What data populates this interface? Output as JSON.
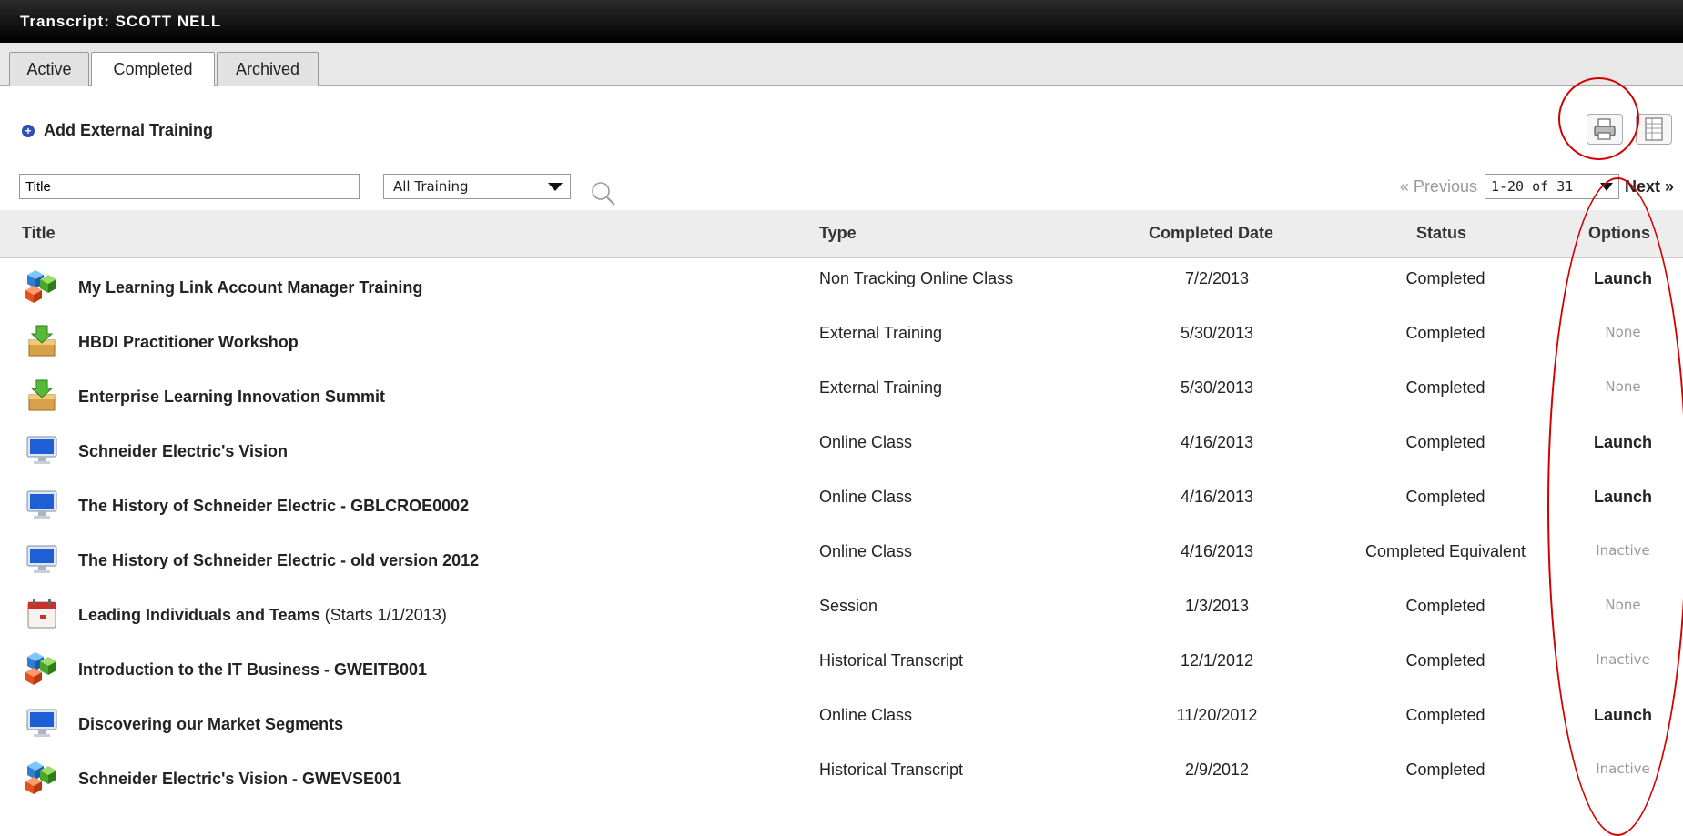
{
  "header": {
    "title": "Transcript: SCOTT NELL"
  },
  "tabs": [
    {
      "label": "Active"
    },
    {
      "label": "Completed",
      "active": true
    },
    {
      "label": "Archived"
    }
  ],
  "actions": {
    "add_external": "Add External Training"
  },
  "filter": {
    "title_value": "Title",
    "type_selected": "All Training"
  },
  "pager": {
    "prev": "« Previous",
    "range": "1-20 of 31",
    "next": "Next »"
  },
  "columns": {
    "title": "Title",
    "type": "Type",
    "date": "Completed Date",
    "status": "Status",
    "options": "Options"
  },
  "rows": [
    {
      "icon": "cubes-icon",
      "title": "My Learning Link Account Manager Training",
      "type": "Non Tracking Online Class",
      "date": "7/2/2013",
      "status": "Completed",
      "option": "Launch"
    },
    {
      "icon": "inbox-download-icon",
      "title": "HBDI Practitioner Workshop",
      "type": "External Training",
      "date": "5/30/2013",
      "status": "Completed",
      "option": "None"
    },
    {
      "icon": "inbox-download-icon",
      "title": "Enterprise Learning Innovation Summit",
      "type": "External Training",
      "date": "5/30/2013",
      "status": "Completed",
      "option": "None"
    },
    {
      "icon": "monitor-icon",
      "title": "Schneider Electric's Vision",
      "type": "Online Class",
      "date": "4/16/2013",
      "status": "Completed",
      "option": "Launch"
    },
    {
      "icon": "monitor-icon",
      "title": "The History of Schneider Electric - GBLCROE0002",
      "type": "Online Class",
      "date": "4/16/2013",
      "status": "Completed",
      "option": "Launch"
    },
    {
      "icon": "monitor-icon",
      "title": "The History of Schneider Electric - old version 2012",
      "type": "Online Class",
      "date": "4/16/2013",
      "status": "Completed Equivalent",
      "option": "Inactive"
    },
    {
      "icon": "calendar-icon",
      "title": "Leading Individuals and Teams",
      "title_suffix": "(Starts 1/1/2013)",
      "type": "Session",
      "date": "1/3/2013",
      "status": "Completed",
      "option": "None"
    },
    {
      "icon": "cubes-icon",
      "title": "Introduction to the IT Business - GWEITB001",
      "type": "Historical Transcript",
      "date": "12/1/2012",
      "status": "Completed",
      "option": "Inactive"
    },
    {
      "icon": "monitor-icon",
      "title": "Discovering our Market Segments",
      "type": "Online Class",
      "date": "11/20/2012",
      "status": "Completed",
      "option": "Launch"
    },
    {
      "icon": "cubes-icon",
      "title": "Schneider Electric's Vision - GWEVSE001",
      "type": "Historical Transcript",
      "date": "2/9/2012",
      "status": "Completed",
      "option": "Inactive"
    }
  ],
  "colors": {
    "annotation": "#d40000",
    "header_bg": "#000000",
    "muted": "#999999"
  }
}
